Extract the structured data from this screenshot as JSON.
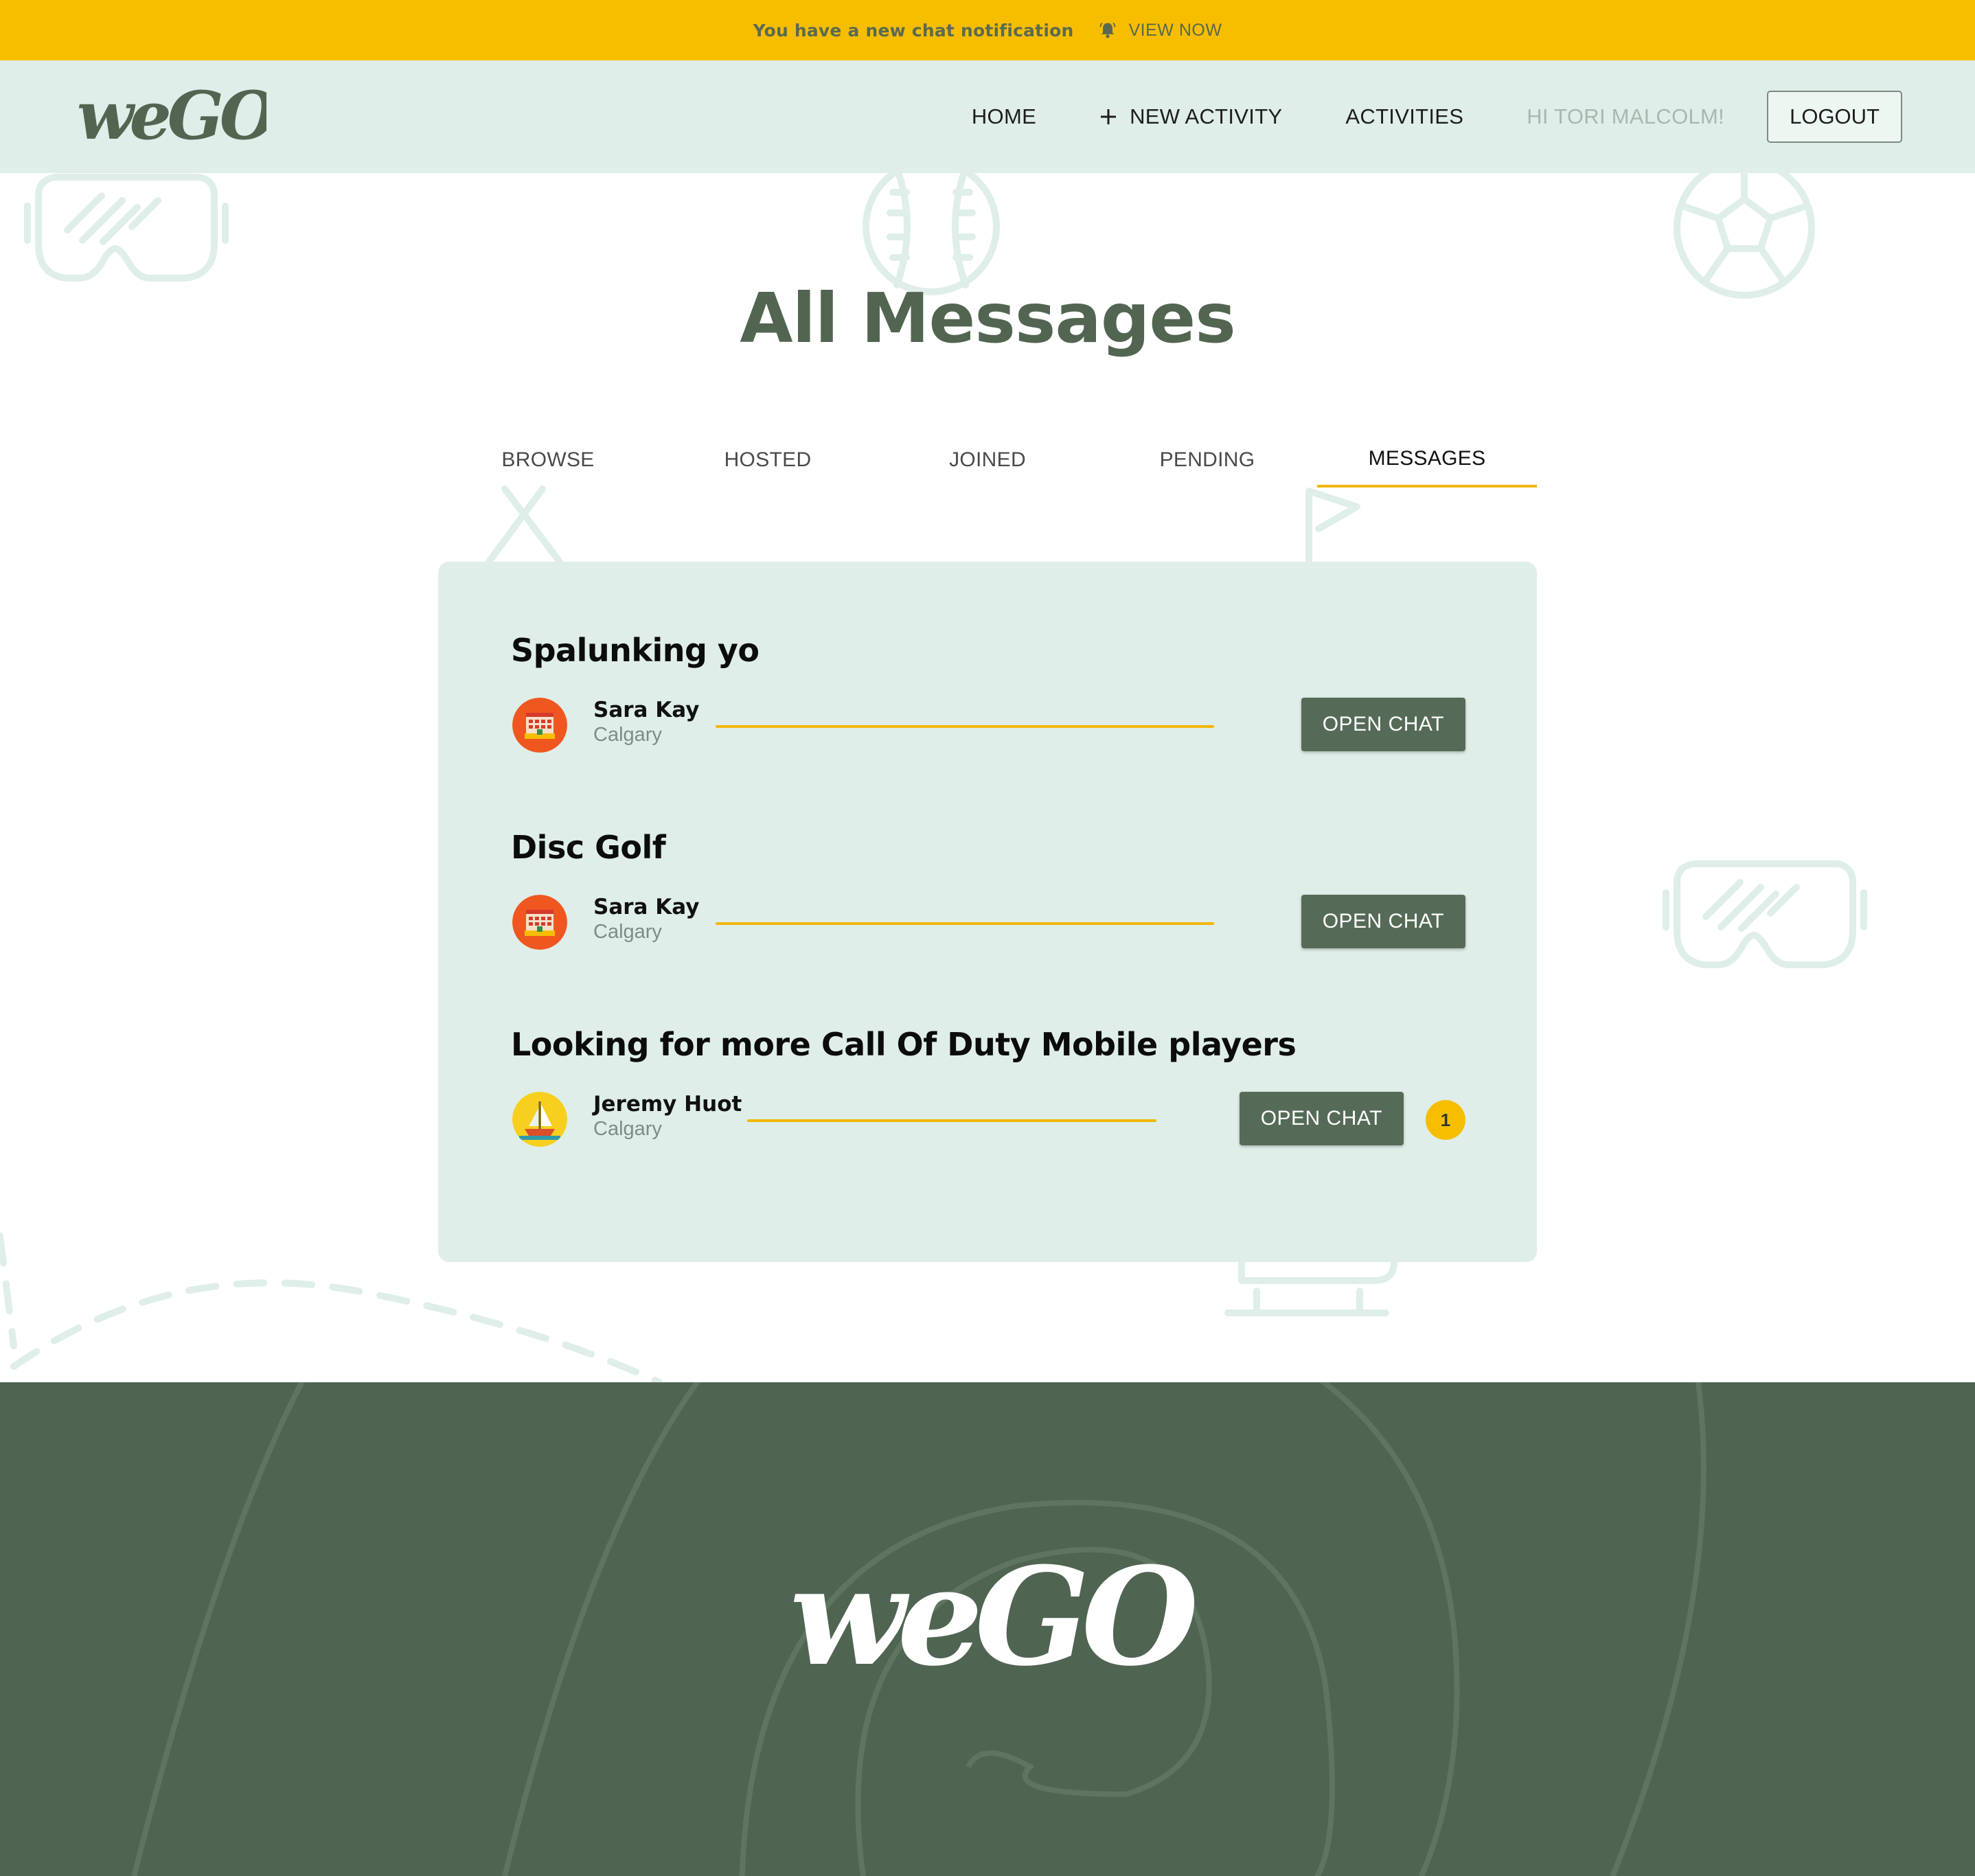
{
  "notification": {
    "message": "You have a new chat notification",
    "bell_icon": "bell-icon",
    "view_label": "VIEW NOW"
  },
  "brand": {
    "logo_text": "weGO"
  },
  "nav": {
    "home": "HOME",
    "new_activity": "NEW ACTIVITY",
    "activities": "ACTIVITIES",
    "greeting": "HI TORI MALCOLM!",
    "logout": "LOGOUT"
  },
  "page": {
    "title": "All Messages"
  },
  "tabs": [
    {
      "label": "BROWSE",
      "active": false
    },
    {
      "label": "HOSTED",
      "active": false
    },
    {
      "label": "JOINED",
      "active": false
    },
    {
      "label": "PENDING",
      "active": false
    },
    {
      "label": "MESSAGES",
      "active": true
    }
  ],
  "threads": [
    {
      "title": "Spalunking yo",
      "user": {
        "name": "Sara Kay",
        "city": "Calgary",
        "avatar_icon": "building-avatar-icon"
      },
      "button_label": "OPEN CHAT"
    },
    {
      "title": "Disc Golf",
      "user": {
        "name": "Sara Kay",
        "city": "Calgary",
        "avatar_icon": "building-avatar-icon"
      },
      "button_label": "OPEN CHAT"
    },
    {
      "title": "Looking for more Call Of Duty Mobile players",
      "user": {
        "name": "Jeremy Huot",
        "city": "Calgary",
        "avatar_icon": "sailboat-avatar-icon"
      },
      "button_label": "OPEN CHAT",
      "unread": "1"
    }
  ],
  "colors": {
    "accent": "#f7be00",
    "brand_green": "#526551",
    "button_green": "#566b57",
    "panel": "#dfeee8",
    "footer": "#506452"
  }
}
